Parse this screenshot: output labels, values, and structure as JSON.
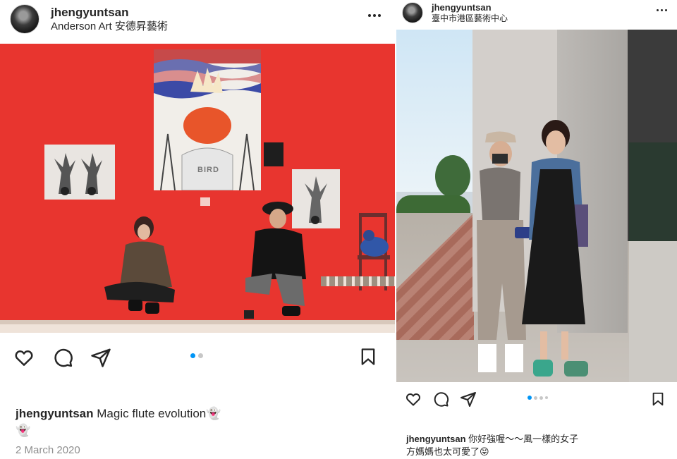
{
  "post1": {
    "username": "jhengyuntsan",
    "location": "Anderson Art 安德昇藝術",
    "caption_username": "jhengyuntsan",
    "caption_text": "Magic flute evolution👻👻",
    "date": "2 March 2020",
    "artwork_label": "BIRD",
    "carousel": {
      "count": 2,
      "active_index": 0
    },
    "colors": {
      "wall": "#e8352f",
      "accent_dot": "#0095f6"
    }
  },
  "post2": {
    "username": "jhengyuntsan",
    "location": "臺中市港區藝術中心",
    "caption_username": "jhengyuntsan",
    "caption_line1": "你好強喔～～風一樣的女子",
    "caption_line2": "方媽媽也太可愛了😝",
    "carousel": {
      "count": 4,
      "active_index": 0
    }
  },
  "icons": {
    "like": "heart-icon",
    "comment": "comment-icon",
    "share": "send-icon",
    "save": "bookmark-icon",
    "more": "more-options-icon"
  }
}
